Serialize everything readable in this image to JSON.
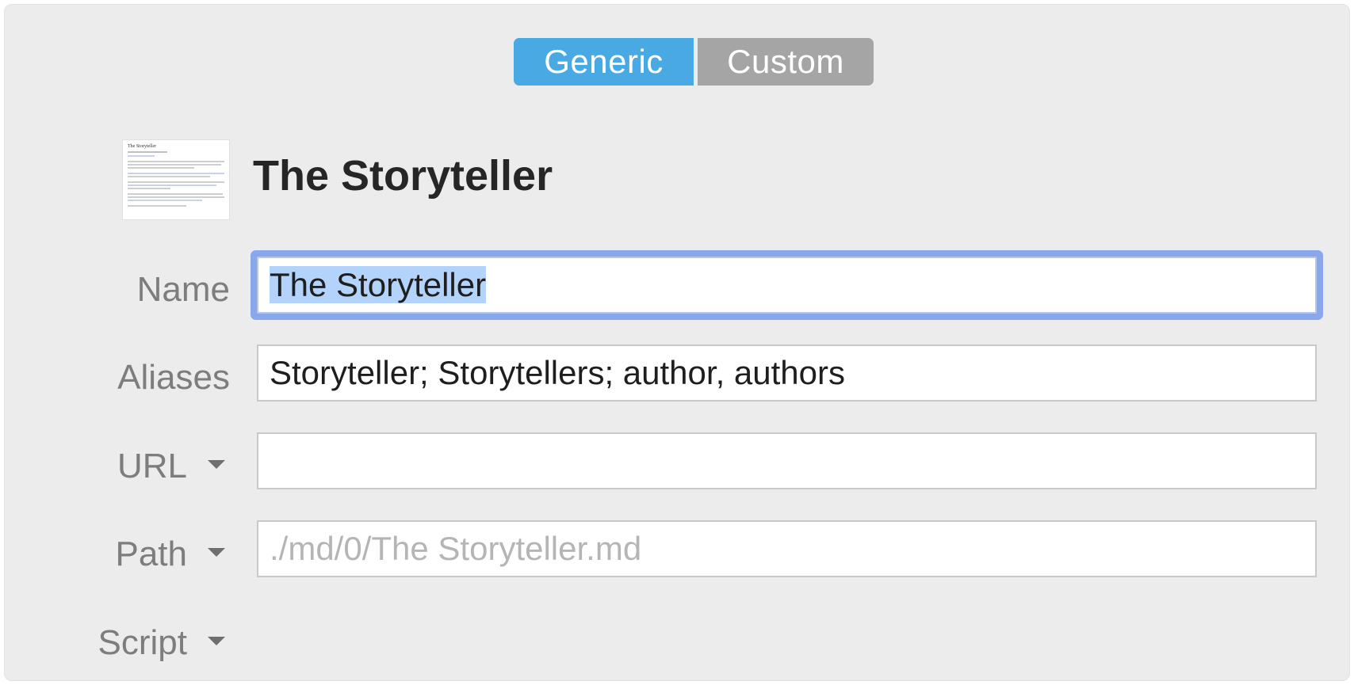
{
  "segmented": {
    "options": [
      "Generic",
      "Custom"
    ],
    "selected": "Generic"
  },
  "header": {
    "title": "The Storyteller",
    "thumbnail_heading": "The Storyteller"
  },
  "form": {
    "name_label": "Name",
    "name_value": "The Storyteller",
    "aliases_label": "Aliases",
    "aliases_value": "Storyteller; Storytellers; author, authors",
    "url_label": "URL",
    "url_value": "",
    "path_label": "Path",
    "path_placeholder": "./md/0/The Storyteller.md",
    "script_label": "Script"
  },
  "colors": {
    "accent": "#49a9e2",
    "segment_inactive": "#a5a5a5",
    "focus_ring": "#89a7ea",
    "selection": "#b4d3fb"
  },
  "icons": [
    "dropdown-caret-icon",
    "document-thumbnail"
  ]
}
